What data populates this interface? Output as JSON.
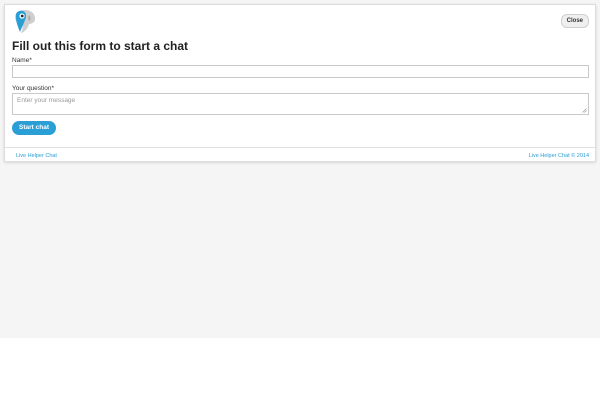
{
  "widget": {
    "close_label": "Close",
    "title": "Fill out this form to start a chat",
    "logo_icon": "parrot-logo-icon"
  },
  "form": {
    "name_label": "Name*",
    "name_value": "",
    "question_label": "Your question*",
    "question_placeholder": "Enter your message",
    "start_chat_label": "Start chat"
  },
  "footer": {
    "left_link": "Live Helper Chat",
    "right_link": "Live Helper Chat © 2014"
  },
  "colors": {
    "accent": "#2a9fd6",
    "page_background": "#f5f5f5"
  }
}
